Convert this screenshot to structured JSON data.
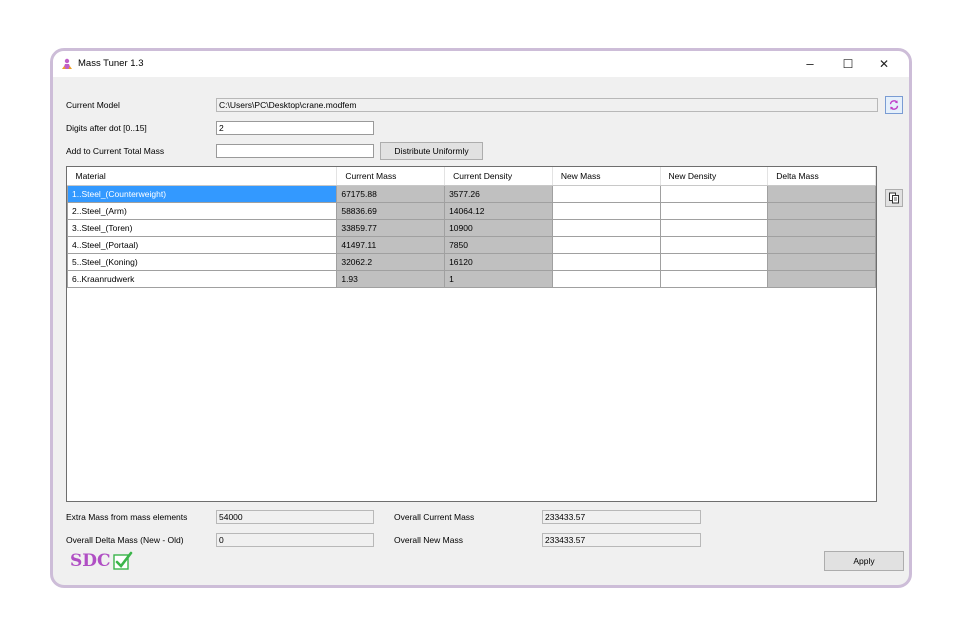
{
  "window": {
    "title": "Mass Tuner 1.3",
    "minimize": "–",
    "maximize": "☐",
    "close": "✕"
  },
  "form": {
    "current_model_label": "Current Model",
    "current_model_value": "C:\\Users\\PC\\Desktop\\crane.modfem",
    "digits_label": "Digits after dot [0..15]",
    "digits_value": "2",
    "add_mass_label": "Add to Current Total Mass",
    "add_mass_value": "",
    "distribute_button": "Distribute Uniformly"
  },
  "table": {
    "columns": [
      "Material",
      "Current Mass",
      "Current Density",
      "New Mass",
      "New Density",
      "Delta Mass"
    ],
    "rows": [
      {
        "material": "1..Steel_(Counterweight)",
        "current_mass": "67175.88",
        "current_density": "3577.26",
        "new_mass": "",
        "new_density": "",
        "delta_mass": ""
      },
      {
        "material": "2..Steel_(Arm)",
        "current_mass": "58836.69",
        "current_density": "14064.12",
        "new_mass": "",
        "new_density": "",
        "delta_mass": ""
      },
      {
        "material": "3..Steel_(Toren)",
        "current_mass": "33859.77",
        "current_density": "10900",
        "new_mass": "",
        "new_density": "",
        "delta_mass": ""
      },
      {
        "material": "4..Steel_(Portaal)",
        "current_mass": "41497.11",
        "current_density": "7850",
        "new_mass": "",
        "new_density": "",
        "delta_mass": ""
      },
      {
        "material": "5..Steel_(Koning)",
        "current_mass": "32062.2",
        "current_density": "16120",
        "new_mass": "",
        "new_density": "",
        "delta_mass": ""
      },
      {
        "material": "6..Kraanrudwerk",
        "current_mass": "1.93",
        "current_density": "1",
        "new_mass": "",
        "new_density": "",
        "delta_mass": ""
      }
    ],
    "selected_row": 0
  },
  "footer": {
    "extra_mass_label": "Extra Mass from mass elements",
    "extra_mass_value": "54000",
    "delta_mass_label": "Overall Delta Mass (New - Old)",
    "delta_mass_value": "0",
    "overall_current_label": "Overall Current Mass",
    "overall_current_value": "233433.57",
    "overall_new_label": "Overall New Mass",
    "overall_new_value": "233433.57",
    "logo_text": "SDC",
    "apply_button": "Apply"
  },
  "icons": {
    "app": "person-icon",
    "refresh": "refresh-icon",
    "copy": "copy-icon",
    "logo_check": "checkmark-icon"
  },
  "colors": {
    "selection": "#3399ff",
    "readonly_cell": "#c0c0c0",
    "logo_purple": "#b04fc4",
    "logo_green": "#3bb54a",
    "frame": "#cdbdd8"
  }
}
